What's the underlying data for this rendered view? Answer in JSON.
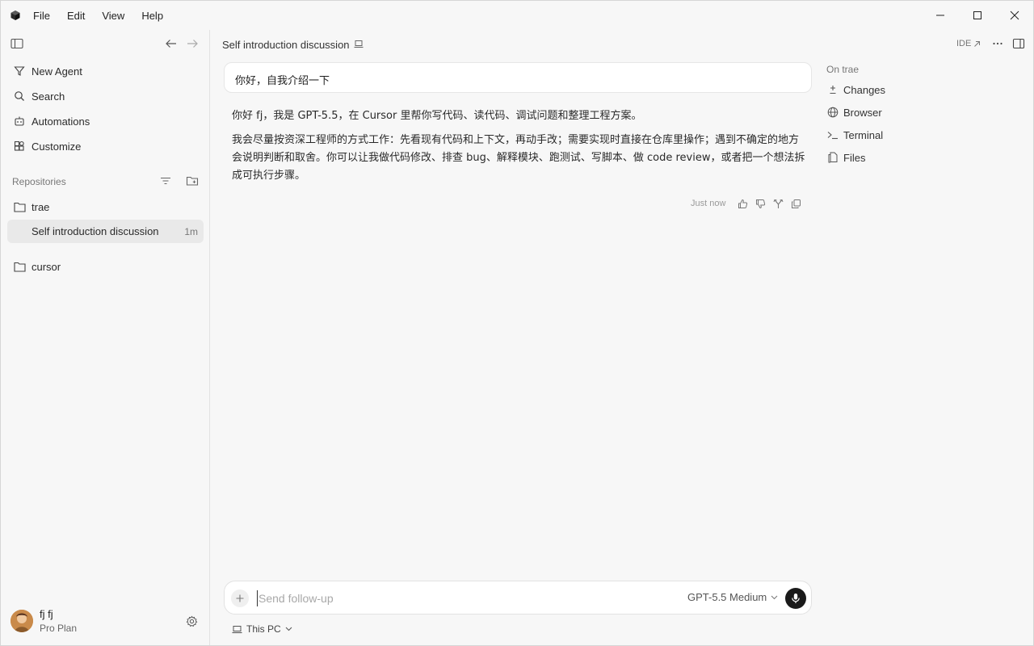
{
  "menu": [
    "File",
    "Edit",
    "View",
    "Help"
  ],
  "sidebar": {
    "nav": [
      {
        "label": "New Agent",
        "icon": "funnel-icon"
      },
      {
        "label": "Search",
        "icon": "search-icon"
      },
      {
        "label": "Automations",
        "icon": "robot-icon"
      },
      {
        "label": "Customize",
        "icon": "blocks-icon"
      }
    ],
    "section_label": "Repositories",
    "repos": [
      {
        "name": "trae"
      },
      {
        "name": "cursor"
      }
    ],
    "chat": {
      "title": "Self introduction discussion",
      "age": "1m"
    },
    "user": {
      "name": "fj fj",
      "plan": "Pro Plan"
    }
  },
  "main": {
    "title": "Self introduction discussion",
    "ide_label": "IDE",
    "user_message": "你好，自我介绍一下",
    "assistant_paragraphs": [
      "你好 fj，我是 GPT-5.5，在 Cursor 里帮你写代码、读代码、调试问题和整理工程方案。",
      "我会尽量按资深工程师的方式工作：先看现有代码和上下文，再动手改；需要实现时直接在仓库里操作；遇到不确定的地方会说明判断和取舍。你可以让我做代码修改、排查 bug、解释模块、跑测试、写脚本、做 code review，或者把一个想法拆成可执行步骤。"
    ],
    "message_time": "Just now",
    "context": {
      "label": "On trae",
      "items": [
        {
          "label": "Changes",
          "icon": "plus-minus-icon"
        },
        {
          "label": "Browser",
          "icon": "globe-icon"
        },
        {
          "label": "Terminal",
          "icon": "terminal-icon"
        },
        {
          "label": "Files",
          "icon": "files-icon"
        }
      ]
    },
    "composer": {
      "placeholder": "Send follow-up",
      "model": "GPT-5.5 Medium",
      "env": "This PC"
    }
  }
}
